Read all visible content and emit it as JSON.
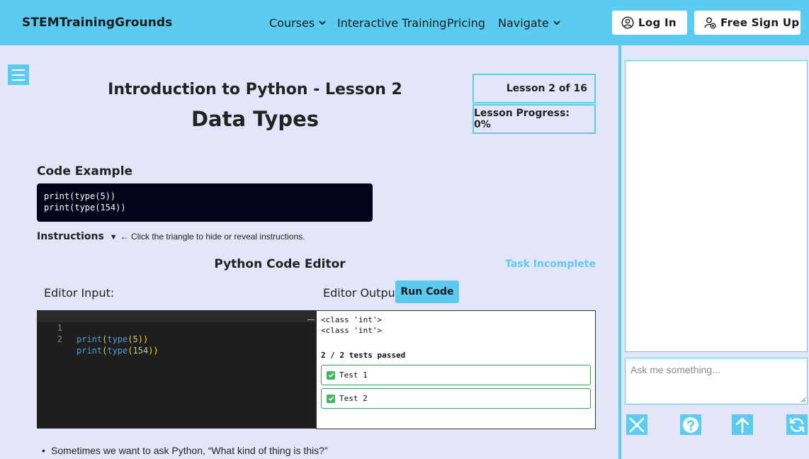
{
  "nav": {
    "brand": "STEMTrainingGrounds",
    "items": [
      {
        "label": "Courses",
        "has_dropdown": true
      },
      {
        "label": "Interactive Training",
        "has_dropdown": false
      },
      {
        "label": "Pricing",
        "has_dropdown": false
      },
      {
        "label": "Navigate",
        "has_dropdown": true
      }
    ],
    "login_label": "Log In",
    "signup_label": "Free Sign Up"
  },
  "lesson": {
    "title": "Introduction to Python - Lesson 2",
    "topic": "Data Types",
    "lesson_count": "Lesson 2 of 16",
    "progress": "Lesson Progress: 0%"
  },
  "code_example": {
    "heading": "Code Example",
    "code": "print(type(5))\nprint(type(154))"
  },
  "instructions": {
    "label": "Instructions",
    "triangle": "▼",
    "hint": "← Click the triangle to hide or reveal instructions."
  },
  "editor": {
    "title": "Python Code Editor",
    "task_status": "Task Incomplete",
    "input_label": "Editor Input:",
    "output_label": "Editor Output:",
    "run_label": "Run Code",
    "lines": [
      {
        "number": "1",
        "fn": "print",
        "fn2": "type",
        "arg": "5"
      },
      {
        "number": "2",
        "fn": "print",
        "fn2": "type",
        "arg": "154"
      }
    ]
  },
  "output": {
    "lines": [
      "<class 'int'>",
      "<class 'int'>"
    ],
    "tests_summary": "2 / 2 tests passed",
    "tests": [
      "Test 1",
      "Test 2"
    ]
  },
  "body": {
    "bullet": "Sometimes we want to ask Python, “What kind of thing is this?”"
  },
  "chat": {
    "placeholder": "Ask me something...",
    "buttons": [
      "close-icon",
      "help-icon",
      "arrow-up-icon",
      "refresh-icon"
    ]
  },
  "colors": {
    "accent": "#5ccbf0",
    "background": "#e3e6f8",
    "code_bg": "#02051a",
    "editor_bg": "#1e1e1e",
    "pass_green": "#3eb55e"
  }
}
